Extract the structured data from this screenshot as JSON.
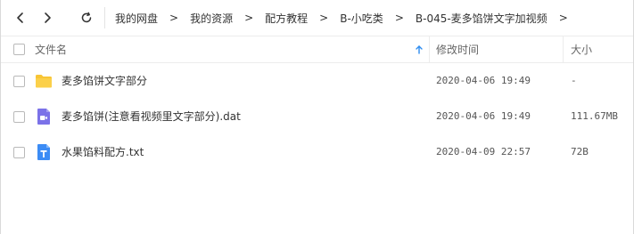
{
  "toolbar": {
    "back_icon": "chevron-left-icon",
    "forward_icon": "chevron-right-icon",
    "refresh_icon": "refresh-icon"
  },
  "breadcrumb": [
    {
      "label": "我的网盘"
    },
    {
      "label": "我的资源"
    },
    {
      "label": "配方教程"
    },
    {
      "label": "B-小吃类"
    },
    {
      "label": "B-045-麦多馅饼文字加视频"
    }
  ],
  "breadcrumb_separator": ">",
  "columns": {
    "name": "文件名",
    "modified": "修改时间",
    "size": "大小"
  },
  "sort": {
    "column": "name",
    "direction": "ascending",
    "icon": "arrow-up-icon",
    "color": "#2d8cf0"
  },
  "files": [
    {
      "name": "麦多馅饼文字部分",
      "modified": "2020-04-06 19:49",
      "size": "-",
      "type": "folder",
      "icon": "folder-icon",
      "color": "#f8c535"
    },
    {
      "name": "麦多馅饼(注意看视频里文字部分).dat",
      "modified": "2020-04-06 19:49",
      "size": "111.67MB",
      "type": "video",
      "icon": "video-file-icon",
      "color": "#7b72e8"
    },
    {
      "name": "水果馅料配方.txt",
      "modified": "2020-04-09 22:57",
      "size": "72B",
      "type": "text",
      "icon": "text-file-icon",
      "color": "#3c8cf5"
    }
  ]
}
